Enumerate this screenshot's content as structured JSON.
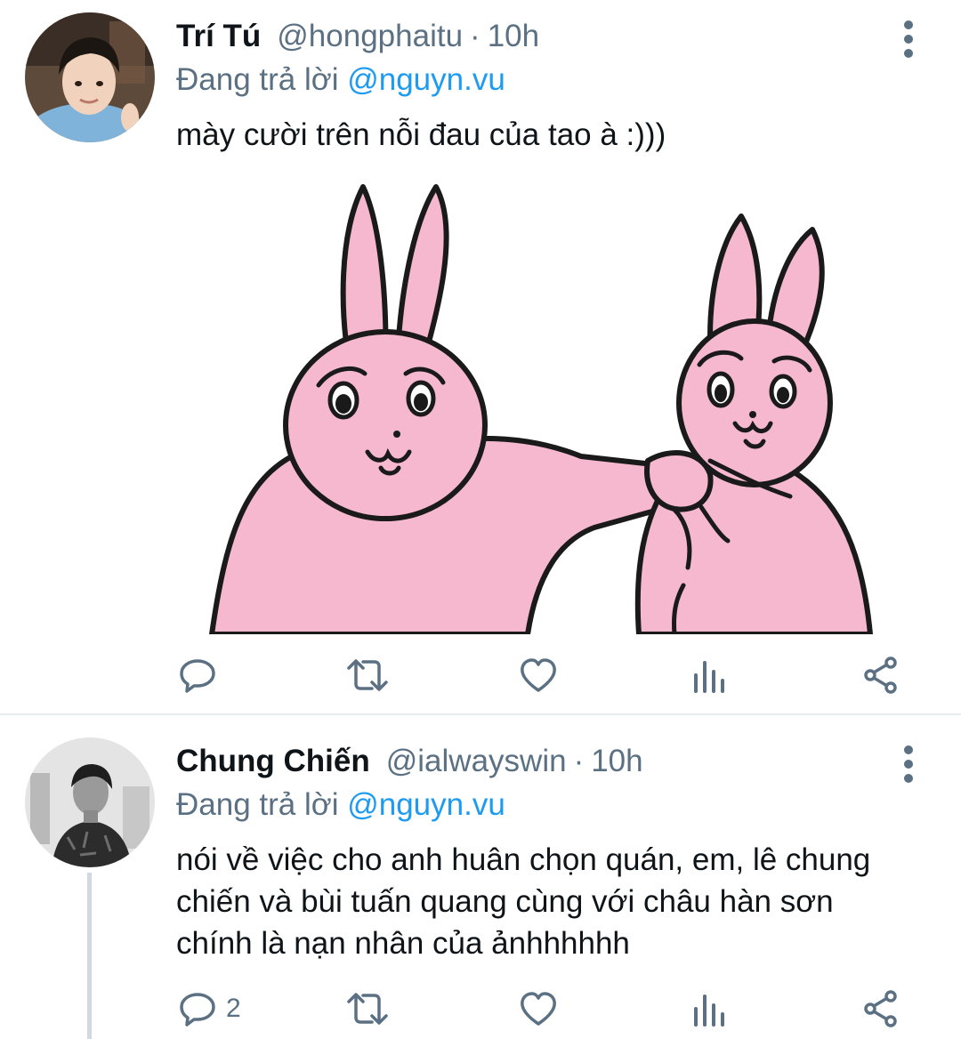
{
  "tweets": [
    {
      "name": "Trí Tú",
      "handle": "@hongphaitu",
      "separator": "·",
      "time": "10h",
      "replying_prefix": "Đang trả lời",
      "replying_to": "@nguyn.vu",
      "text": "mày cười trên nỗi đau của tao à :)))",
      "media": "pink-rabbits-sticker",
      "reply_count": "",
      "icons": [
        "avatar",
        "more-vertical-icon",
        "reply-icon",
        "retweet-icon",
        "like-icon",
        "analytics-icon",
        "share-icon"
      ]
    },
    {
      "name": "Chung Chiến",
      "handle": "@ialwayswin",
      "separator": "·",
      "time": "10h",
      "replying_prefix": "Đang trả lời",
      "replying_to": "@nguyn.vu",
      "text": "nói về việc cho anh huân chọn quán, em, lê chung chiến và bùi tuấn quang cùng với châu hàn sơn chính là nạn nhân của ảnhhhhhh",
      "reply_count": "2",
      "icons": [
        "avatar",
        "more-vertical-icon",
        "reply-icon",
        "retweet-icon",
        "like-icon",
        "analytics-icon",
        "share-icon"
      ]
    }
  ],
  "colors": {
    "text": "#0f1419",
    "secondary": "#5b7083",
    "link": "#1d9bf0",
    "divider": "#e6ecf0",
    "thread_line": "#cfd9de",
    "rabbit_pink": "#f5b8cf",
    "outline": "#1a1a1a"
  }
}
